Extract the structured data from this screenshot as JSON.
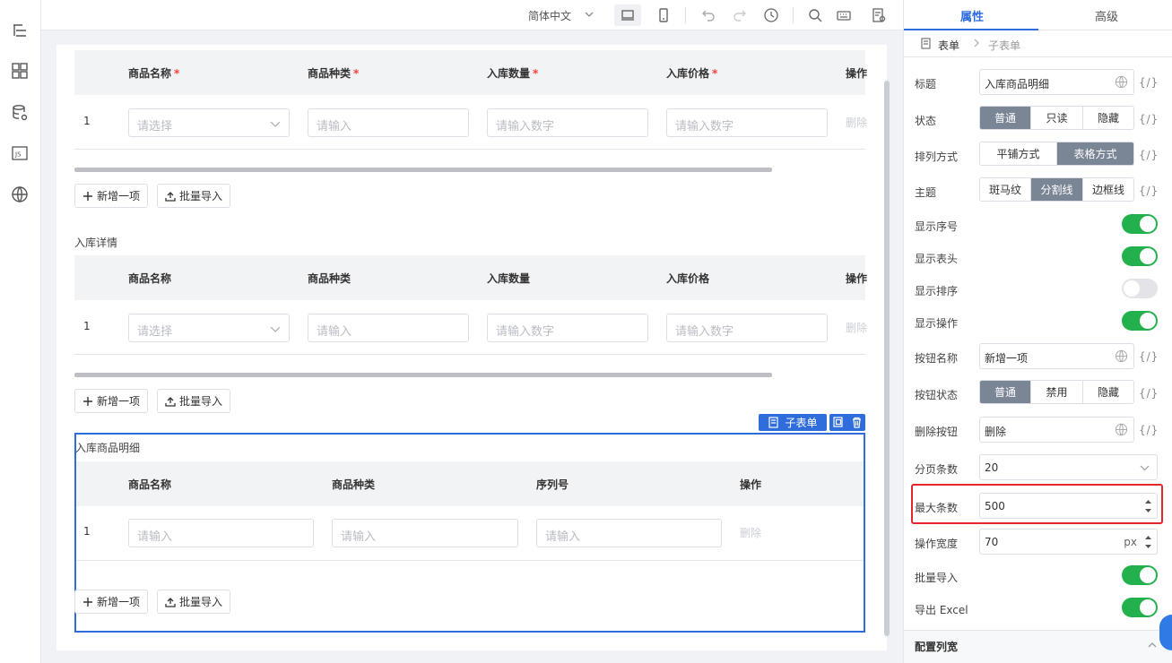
{
  "toolbar": {
    "language": "简体中文"
  },
  "tables": [
    {
      "columns": [
        {
          "label": "商品名称",
          "required": "*"
        },
        {
          "label": "商品种类",
          "required": "*"
        },
        {
          "label": "入库数量",
          "required": "*"
        },
        {
          "label": "入库价格",
          "required": "*"
        },
        {
          "label": "操作",
          "required": ""
        }
      ],
      "row": {
        "index": "1",
        "cells": [
          "请选择",
          "请输入",
          "请输入数字",
          "请输入数字"
        ],
        "delete": "删除"
      },
      "add_button": "新增一项",
      "import_button": "批量导入"
    },
    {
      "title": "入库详情",
      "columns": [
        {
          "label": "商品名称"
        },
        {
          "label": "商品种类"
        },
        {
          "label": "入库数量"
        },
        {
          "label": "入库价格"
        },
        {
          "label": "操作"
        }
      ],
      "row": {
        "index": "1",
        "cells": [
          "请选择",
          "请输入",
          "请输入数字",
          "请输入数字"
        ],
        "delete": "删除"
      },
      "add_button": "新增一项",
      "import_button": "批量导入"
    },
    {
      "title": "入库商品明细",
      "tag": "子表单",
      "columns": [
        {
          "label": "商品名称"
        },
        {
          "label": "商品种类"
        },
        {
          "label": "序列号"
        },
        {
          "label": "操作"
        }
      ],
      "row": {
        "index": "1",
        "cells": [
          "请输入",
          "请输入",
          "请输入"
        ],
        "delete": "删除"
      },
      "add_button": "新增一项",
      "import_button": "批量导入"
    }
  ],
  "panel": {
    "tabs": [
      "属性",
      "高级"
    ],
    "breadcrumb": [
      "表单",
      "子表单"
    ],
    "fx_label": "{/}",
    "fields": {
      "title": {
        "label": "标题",
        "value": "入库商品明细"
      },
      "status": {
        "label": "状态",
        "options": [
          "普通",
          "只读",
          "隐藏"
        ],
        "selected": "普通"
      },
      "layout": {
        "label": "排列方式",
        "options": [
          "平铺方式",
          "表格方式"
        ],
        "selected": "表格方式"
      },
      "theme": {
        "label": "主题",
        "options": [
          "斑马纹",
          "分割线",
          "边框线"
        ],
        "selected": "分割线"
      },
      "show_index": {
        "label": "显示序号",
        "on": true
      },
      "show_header": {
        "label": "显示表头",
        "on": true
      },
      "show_sort": {
        "label": "显示排序",
        "on": false
      },
      "show_ops": {
        "label": "显示操作",
        "on": true
      },
      "button_name": {
        "label": "按钮名称",
        "value": "新增一项"
      },
      "button_status": {
        "label": "按钮状态",
        "options": [
          "普通",
          "禁用",
          "隐藏"
        ],
        "selected": "普通"
      },
      "delete_button": {
        "label": "删除按钮",
        "value": "删除"
      },
      "page_size": {
        "label": "分页条数",
        "value": "20"
      },
      "max_count": {
        "label": "最大条数",
        "value": "500"
      },
      "op_width": {
        "label": "操作宽度",
        "value": "70",
        "unit": "px"
      },
      "batch_import": {
        "label": "批量导入",
        "on": true
      },
      "export_excel": {
        "label": "导出 Excel",
        "on": true
      }
    },
    "collapse_title": "配置列宽"
  },
  "colors": {
    "accent": "#2f6ddc",
    "toggle_on": "#22b14c",
    "highlight": "#e5262b"
  }
}
